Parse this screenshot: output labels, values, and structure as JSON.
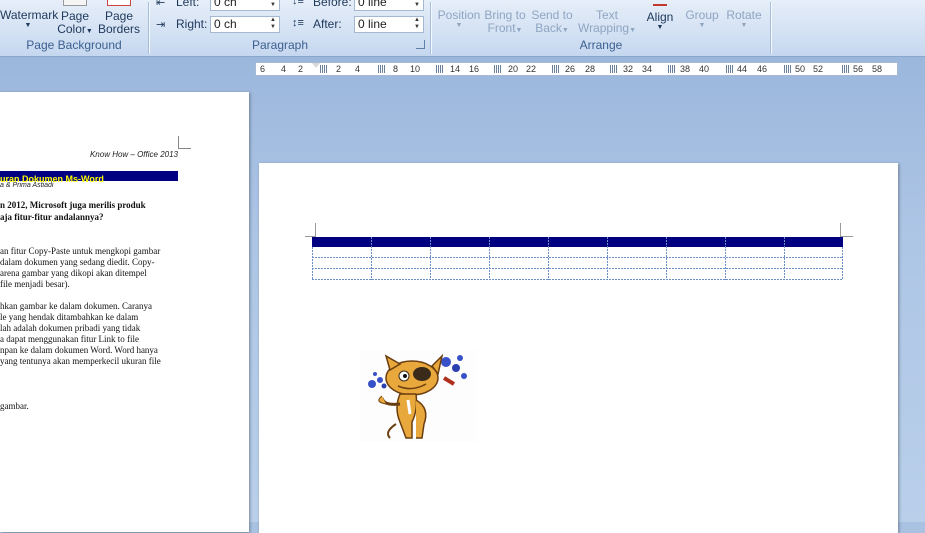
{
  "page_background_group": {
    "label": "Page Background",
    "watermark": "Watermark",
    "page_color_line1": "Page",
    "page_color_line2": "Color",
    "page_borders_line1": "Page",
    "page_borders_line2": "Borders"
  },
  "paragraph_group": {
    "label": "Paragraph",
    "indent_left_label": "Left:",
    "indent_left_value": "0 ch",
    "indent_right_label": "Right:",
    "indent_right_value": "0 ch",
    "spacing_before_label": "Before:",
    "spacing_before_value": "0 line",
    "spacing_after_label": "After:",
    "spacing_after_value": "0 line"
  },
  "arrange_group": {
    "label": "Arrange",
    "position": "Position",
    "bring_line1": "Bring to",
    "bring_line2": "Front",
    "send_line1": "Send to",
    "send_line2": "Back",
    "wrap_line1": "Text",
    "wrap_line2": "Wrapping",
    "align": "Align",
    "group": "Group",
    "rotate": "Rotate"
  },
  "ruler": {
    "ticks": [
      "6",
      "4",
      "2",
      "2",
      "4",
      "8",
      "10",
      "14",
      "16",
      "20",
      "22",
      "26",
      "28",
      "32",
      "34",
      "38",
      "40",
      "44",
      "46",
      "50",
      "52",
      "56",
      "58"
    ]
  },
  "left_page": {
    "header_text": "Know How – Office 2013",
    "title_bar": "uran Dokumen Ms-Word",
    "author_line": "a & Prima Astiadi",
    "question_line1": "n 2012, Microsoft juga merilis produk",
    "question_line2": "aja fitur-fitur andalannya?",
    "para1": [
      "an fitur Copy-Paste untuk mengkopi gambar",
      "dalam dokumen yang sedang diedit. Copy-",
      "arena gambar yang dikopi akan ditempel",
      " file menjadi besar)."
    ],
    "para2": [
      "hkan gambar ke dalam dokumen. Caranya",
      "le yang hendak ditambahkan ke dalam",
      "lah adalah dokumen pribadi yang tidak",
      "a dapat menggunakan fitur Link to file",
      "npan ke dalam dokumen Word. Word hanya",
      "yang tentunya akan memperkecil ukuran file"
    ],
    "para3": "gambar."
  },
  "colors": {
    "table_header": "#000080",
    "title_bar_bg": "#000080",
    "title_bar_text": "#ffff00"
  }
}
